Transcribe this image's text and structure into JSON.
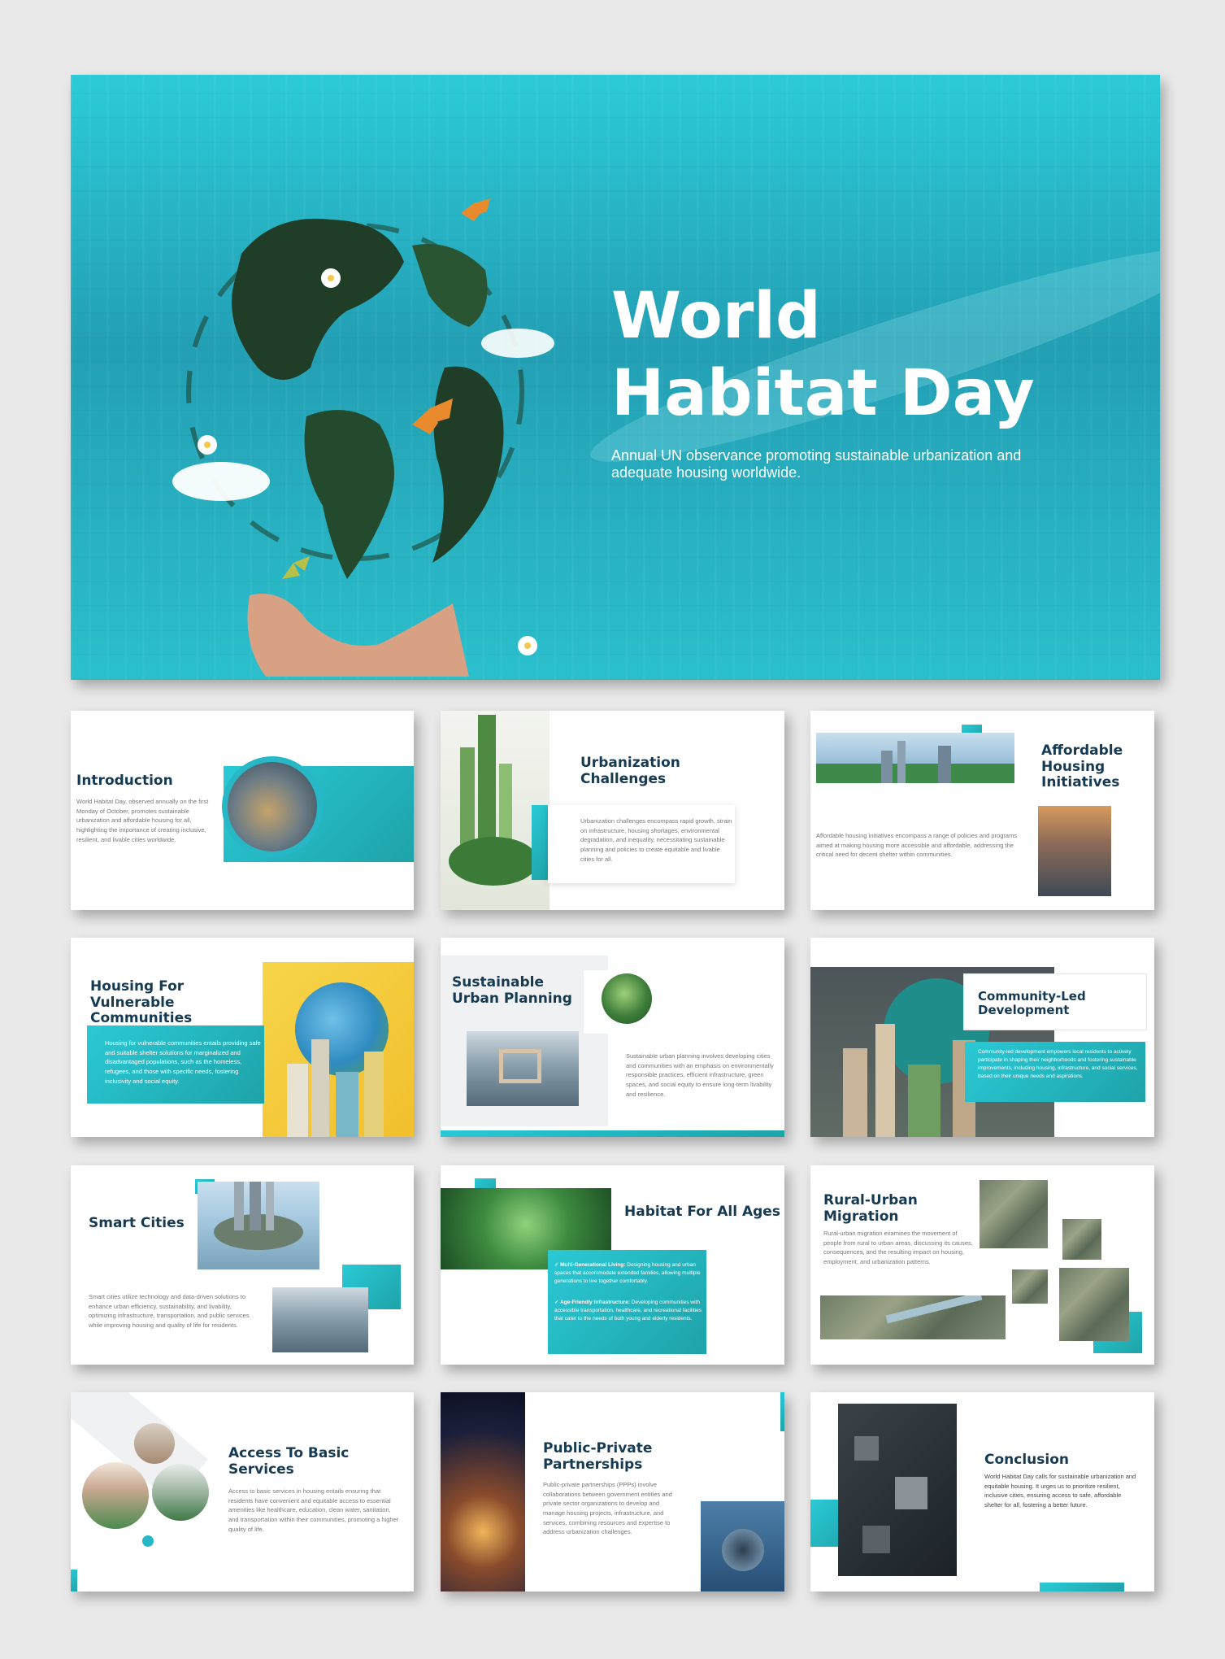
{
  "hero": {
    "title_line1": "World",
    "title_line2": "Habitat Day",
    "subtitle": "Annual UN observance promoting sustainable urbanization and adequate housing worldwide."
  },
  "slides": {
    "introduction": {
      "title": "Introduction",
      "body": "World Habitat Day, observed annually on the first Monday of October, promotes sustainable urbanization and affordable housing for all, highlighting the importance of creating inclusive, resilient, and livable cities worldwide."
    },
    "urbanization": {
      "title": "Urbanization Challenges",
      "body": "Urbanization challenges encompass rapid growth, strain on infrastructure, housing shortages, environmental degradation, and inequality, necessitating sustainable planning and policies to create equitable and livable cities for all."
    },
    "affordable": {
      "title": "Affordable Housing Initiatives",
      "body": "Affordable housing initiatives encompass a range of policies and programs aimed at making housing more accessible and affordable, addressing the critical need for decent shelter within communities."
    },
    "vulnerable": {
      "title": "Housing For Vulnerable Communities",
      "body": "Housing for vulnerable communities entails providing safe and suitable shelter solutions for marginalized and disadvantaged populations, such as the homeless, refugees, and those with specific needs, fostering inclusivity and social equity."
    },
    "sustainable": {
      "title": "Sustainable Urban Planning",
      "body": "Sustainable urban planning involves developing cities and communities with an emphasis on environmentally responsible practices, efficient infrastructure, green spaces, and social equity to ensure long-term livability and resilience."
    },
    "community": {
      "title": "Community-Led Development",
      "body": "Community-led development empowers local residents to actively participate in shaping their neighborhoods and fostering sustainable improvements, including housing, infrastructure, and social services, based on their unique needs and aspirations."
    },
    "smart": {
      "title": "Smart Cities",
      "body": "Smart cities utilize technology and data-driven solutions to enhance urban efficiency, sustainability, and livability, optimizing infrastructure, transportation, and public services while improving housing and quality of life for residents."
    },
    "ages": {
      "title": "Habitat For All Ages",
      "item1_label": "Multi-Generational Living:",
      "item1_text": "Designing housing and urban spaces that accommodate extended families, allowing multiple generations to live together comfortably.",
      "item2_label": "Age-Friendly Infrastructure:",
      "item2_text": "Developing communities with accessible transportation, healthcare, and recreational facilities that cater to the needs of both young and elderly residents."
    },
    "rural": {
      "title": "Rural-Urban Migration",
      "body": "Rural-urban migration examines the movement of people from rural to urban areas, discussing its causes, consequences, and the resulting impact on housing, employment, and urbanization patterns."
    },
    "access": {
      "title": "Access To Basic Services",
      "body": "Access to basic services in housing entails ensuring that residents have convenient and equitable access to essential amenities like healthcare, education, clean water, sanitation, and transportation within their communities, promoting a higher quality of life."
    },
    "ppp": {
      "title": "Public-Private Partnerships",
      "body": "Public-private partnerships (PPPs) involve collaborations between government entities and private sector organizations to develop and manage housing projects, infrastructure, and services, combining resources and expertise to address urbanization challenges."
    },
    "conclusion": {
      "title": "Conclusion",
      "body": "World Habitat Day calls for sustainable urbanization and equitable housing. It urges us to prioritize resilient, inclusive cities, ensuring access to safe, affordable shelter for all, fostering a better future."
    }
  },
  "colors": {
    "accent": "#2ac9d6",
    "accent_dark": "#1ea3a8",
    "title": "#163a52",
    "background": "#e9e9e9"
  }
}
